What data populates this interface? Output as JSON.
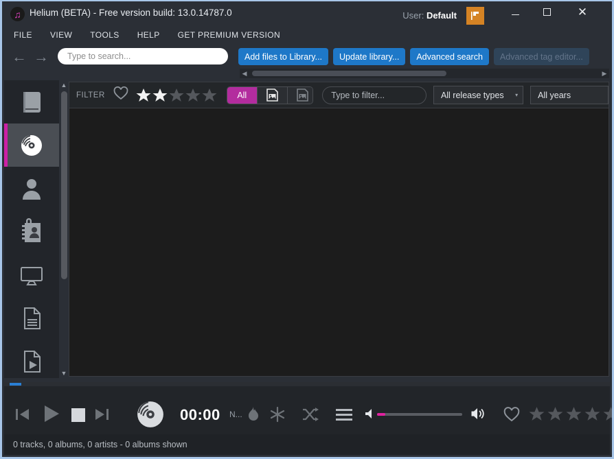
{
  "window": {
    "title": "Helium (BETA) - Free version build: 13.0.14787.0",
    "logo_icon": "music-note-icon",
    "user_label": "User:",
    "user_value": "Default",
    "flag_icon": "flag-icon",
    "minimize_icon": "minimize-icon",
    "maximize_icon": "maximize-icon",
    "close_icon": "close-icon",
    "close_glyph": "✕",
    "border_color": "#a8c6e8",
    "titlebar_color": "#2b2f36",
    "flag_color": "#d58324"
  },
  "menubar": {
    "items": [
      {
        "label": "FILE",
        "name": "menu-file"
      },
      {
        "label": "VIEW",
        "name": "menu-view"
      },
      {
        "label": "TOOLS",
        "name": "menu-tools"
      },
      {
        "label": "HELP",
        "name": "menu-help"
      },
      {
        "label": "GET PREMIUM VERSION",
        "name": "menu-get-premium-version"
      }
    ]
  },
  "toolbar": {
    "back_icon": "arrow-left-icon",
    "back_glyph": "←",
    "forward_icon": "arrow-right-icon",
    "forward_glyph": "→",
    "search_placeholder": "Type to search...",
    "buttons": [
      {
        "label": "Add files to Library...",
        "name": "add-files-to-library-button",
        "disabled": false
      },
      {
        "label": "Update library...",
        "name": "update-library-button",
        "disabled": false
      },
      {
        "label": "Advanced search",
        "name": "advanced-search-button",
        "disabled": false
      },
      {
        "label": "Advanced tag editor...",
        "name": "advanced-tag-editor-button",
        "disabled": true
      }
    ],
    "button_color": "#1e78c8",
    "disabled_button_color": "#2f4459",
    "scroll_left_glyph": "◀",
    "scroll_right_glyph": "▶"
  },
  "sidebar": {
    "items": [
      {
        "name": "sidebar-item-library",
        "icon": "book-icon",
        "active": false
      },
      {
        "name": "sidebar-item-albums",
        "icon": "disc-icon",
        "active": true
      },
      {
        "name": "sidebar-item-artists",
        "icon": "person-icon",
        "active": false
      },
      {
        "name": "sidebar-item-contacts",
        "icon": "contact-book-icon",
        "active": false
      },
      {
        "name": "sidebar-item-display",
        "icon": "monitor-icon",
        "active": false
      },
      {
        "name": "sidebar-item-documents",
        "icon": "document-icon",
        "active": false
      },
      {
        "name": "sidebar-item-videos",
        "icon": "video-document-icon",
        "active": false
      }
    ],
    "active_accent": "#cc1fa5",
    "scroll_up_glyph": "▲",
    "scroll_down_glyph": "▼"
  },
  "filterbar": {
    "label": "FILTER",
    "heart_icon": "heart-outline-icon",
    "rating": {
      "filled": 2,
      "total": 5
    },
    "view_modes": [
      {
        "label": "All",
        "name": "filter-mode-all",
        "selected": true,
        "icon": ""
      },
      {
        "label": "",
        "name": "filter-mode-with-art",
        "selected": false,
        "icon": "image-with-art-icon"
      },
      {
        "label": "",
        "name": "filter-mode-without-art",
        "selected": false,
        "icon": "image-no-art-icon"
      }
    ],
    "selected_color": "#b32c9e",
    "filter_placeholder": "Type to filter...",
    "release_types": {
      "value": "All release types",
      "chevron": "▾"
    },
    "years": {
      "value": "All years"
    }
  },
  "seekbar": {
    "progress_color": "#2a7fd4",
    "progress_percent": 2
  },
  "player": {
    "previous_icon": "previous-track-icon",
    "play_icon": "play-icon",
    "stop_icon": "stop-icon",
    "next_icon": "next-track-icon",
    "now_playing_icon": "disc-icon",
    "time": "00:00",
    "next_text": "N...",
    "flame_icon": "flame-icon",
    "snowflake_icon": "snowflake-icon",
    "shuffle_icon": "shuffle-icon",
    "queue_icon": "hamburger-menu-icon",
    "volume_low_icon": "volume-low-icon",
    "volume_high_icon": "volume-high-icon",
    "volume_percent": 10,
    "volume_fill_color": "#e0219f",
    "favorite_icon": "heart-outline-icon",
    "rating": {
      "filled": 0,
      "total": 5
    }
  },
  "statusbar": {
    "text": "0 tracks, 0 albums, 0 artists - 0 albums shown"
  }
}
